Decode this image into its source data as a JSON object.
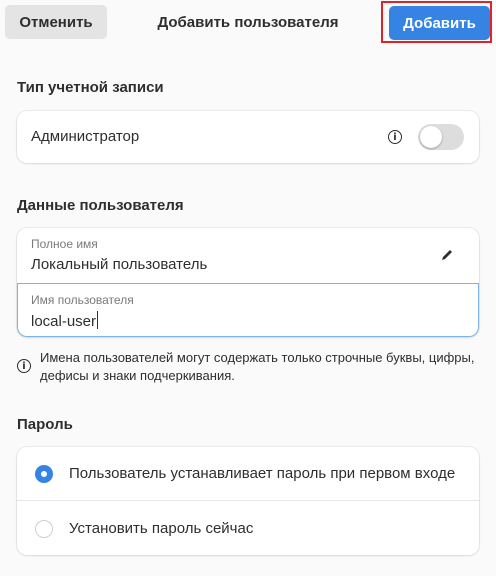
{
  "header": {
    "cancel_label": "Отменить",
    "title": "Добавить пользователя",
    "add_label": "Добавить"
  },
  "account_type": {
    "section_title": "Тип учетной записи",
    "admin_label": "Администратор",
    "admin_enabled": false
  },
  "user_data": {
    "section_title": "Данные пользователя",
    "fullname_label": "Полное имя",
    "fullname_value": "Локальный пользователь",
    "username_label": "Имя пользователя",
    "username_value": "local-user",
    "username_note": "Имена пользователей могут содержать только строчные буквы, цифры, дефисы и знаки подчеркивания."
  },
  "password": {
    "section_title": "Пароль",
    "options": [
      {
        "label": "Пользователь устанавливает пароль при первом входе",
        "selected": true
      },
      {
        "label": "Установить пароль сейчас",
        "selected": false
      }
    ]
  },
  "colors": {
    "accent": "#3584e4",
    "highlight_border": "#e0222b"
  }
}
